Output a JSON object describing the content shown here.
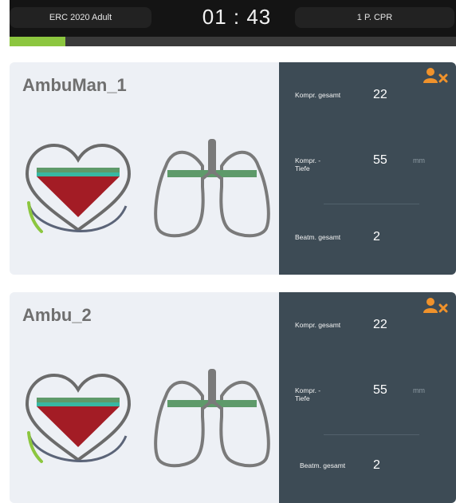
{
  "header": {
    "protocol_label": "ERC 2020 Adult",
    "timer": "01 : 43",
    "mode_label": "1 P. CPR",
    "session_progress": 0.125,
    "accent_color": "#8cc63f"
  },
  "cards": [
    {
      "name": "AmbuMan_1",
      "remove_icon": "user-remove-icon",
      "stats": {
        "compressions_total_label": "Kompr. gesamt",
        "compressions_total_value": "22",
        "compression_depth_label_line1": "Kompr. -",
        "compression_depth_label_line2": "Tiefe",
        "compression_depth_value": "55",
        "compression_depth_unit": "mm",
        "ventilations_total_label": "Beatm. gesamt",
        "ventilations_total_value": "2"
      }
    },
    {
      "name": "Ambu_2",
      "remove_icon": "user-remove-icon",
      "stats": {
        "compressions_total_label": "Kompr. gesamt",
        "compressions_total_value": "22",
        "compression_depth_label_line1": "Kompr. -",
        "compression_depth_label_line2": "Tiefe",
        "compression_depth_value": "55",
        "compression_depth_unit": "mm",
        "ventilations_total_label": "Beatm. gesamt",
        "ventilations_total_value": "2"
      }
    }
  ],
  "colors": {
    "panel_dark": "#3d4b55",
    "card_background": "#edf0f5",
    "heart_fill": "#a31c25",
    "depth_band_green": "#5e9a6a",
    "depth_band_teal": "#38b7a2",
    "lungs_band_green": "#5e9a6a",
    "remove_icon_orange": "#f0922b"
  }
}
